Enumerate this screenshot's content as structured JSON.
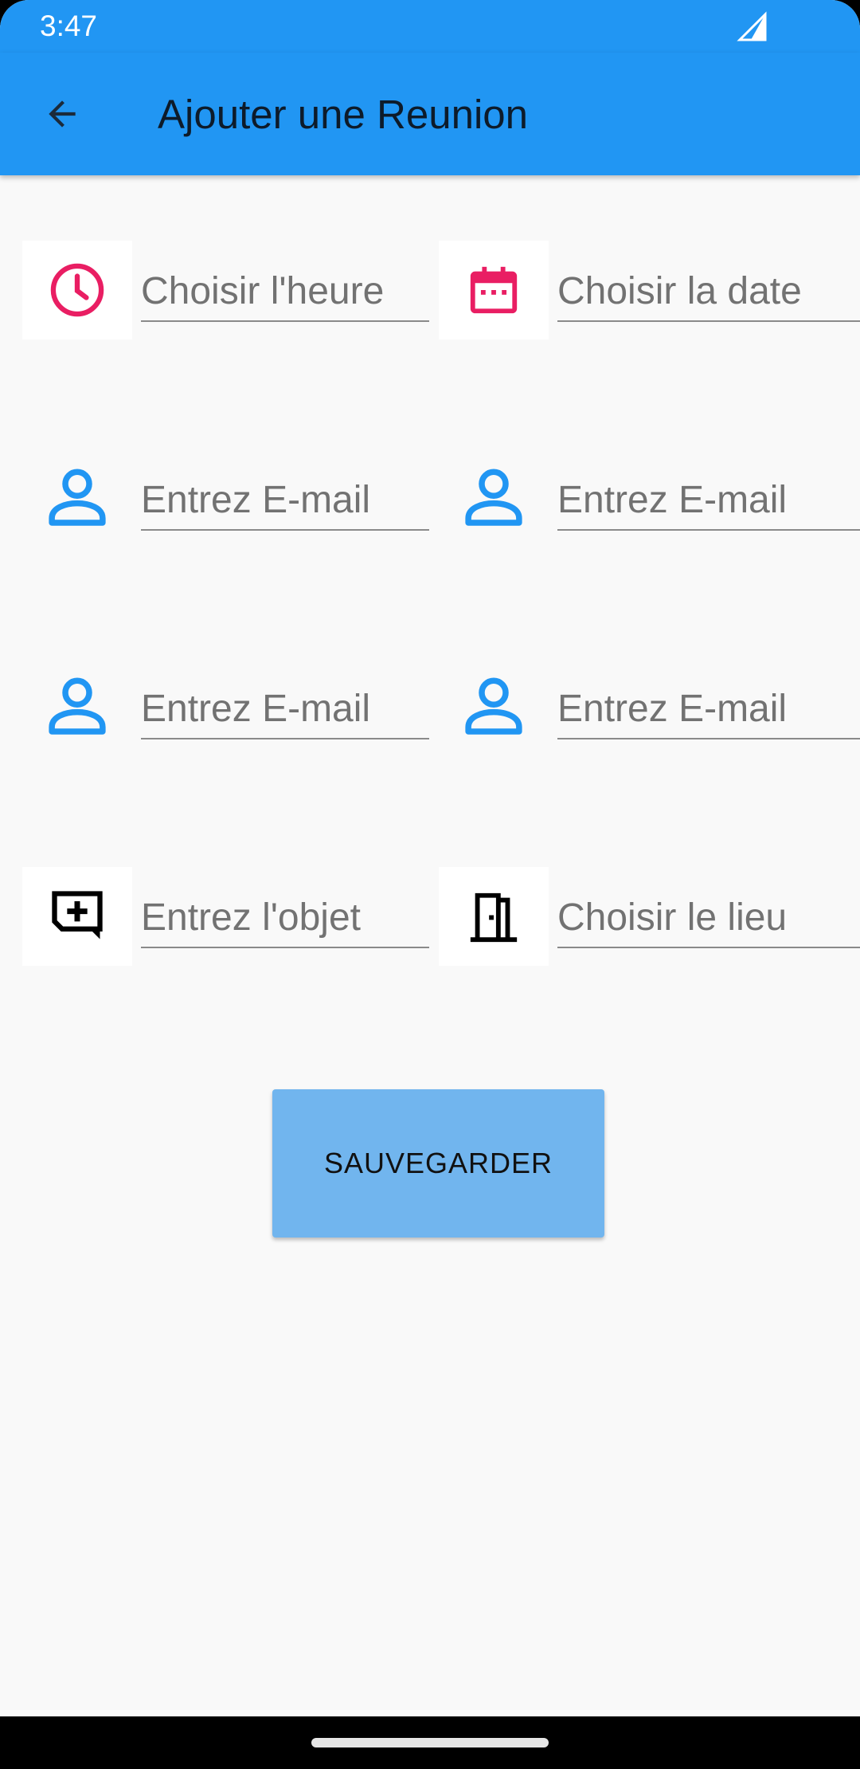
{
  "status_bar": {
    "time": "3:47",
    "signal_icon": "cell-signal-icon"
  },
  "app_bar": {
    "back_icon": "arrow-back-icon",
    "title": "Ajouter une Reunion"
  },
  "fields": {
    "time": {
      "placeholder": "Choisir l'heure",
      "icon": "clock-icon",
      "icon_color": "#e91e63"
    },
    "date": {
      "placeholder": "Choisir la date",
      "icon": "calendar-icon",
      "icon_color": "#e91e63"
    },
    "email_1": {
      "placeholder": "Entrez E-mail",
      "icon": "person-icon",
      "icon_color": "#2196f3"
    },
    "email_2": {
      "placeholder": "Entrez E-mail",
      "icon": "person-icon",
      "icon_color": "#2196f3"
    },
    "email_3": {
      "placeholder": "Entrez E-mail",
      "icon": "person-icon",
      "icon_color": "#2196f3"
    },
    "email_4": {
      "placeholder": "Entrez E-mail",
      "icon": "person-icon",
      "icon_color": "#2196f3"
    },
    "subject": {
      "placeholder": "Entrez l'objet",
      "icon": "add-comment-icon",
      "icon_color": "#000000"
    },
    "location": {
      "placeholder": "Choisir le lieu",
      "icon": "door-icon",
      "icon_color": "#000000"
    }
  },
  "save_button": {
    "label": "SAUVEGARDER"
  },
  "colors": {
    "primary": "#2196f3",
    "accent": "#e91e63",
    "button": "#71b5ee",
    "background": "#f9f9f9"
  }
}
